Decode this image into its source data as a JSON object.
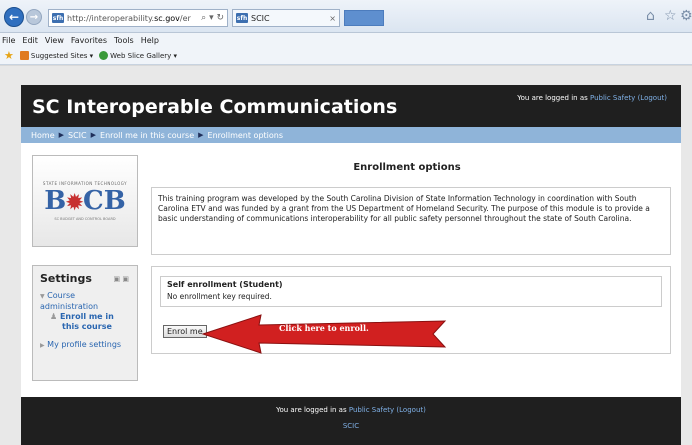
{
  "browser": {
    "url_prefix": "http://interoperability.",
    "url_domain": "sc.gov",
    "url_suffix": "/er",
    "addr_icons": "⌕ ▾ ↻",
    "favicon_text": "sfh",
    "tab_title": "SCIC",
    "tab_close": "×",
    "menu": [
      "File",
      "Edit",
      "View",
      "Favorites",
      "Tools",
      "Help"
    ],
    "favorites": {
      "suggested": "Suggested Sites ▾",
      "webslice": "Web Slice Gallery ▾"
    }
  },
  "header": {
    "site_title": "SC Interoperable Communications",
    "login_prefix": "You are logged in as ",
    "login_user": "Public Safety",
    "logout": "(Logout)"
  },
  "breadcrumb": [
    "Home",
    "SCIC",
    "Enroll me in this course",
    "Enrollment options"
  ],
  "breadcrumb_sep": "▶",
  "logo": {
    "top": "STATE INFORMATION TECHNOLOGY",
    "mark_left": "B",
    "mark_mid": "✹",
    "mark_right": "CB",
    "bottom": "SC BUDGET AND CONTROL BOARD"
  },
  "settings": {
    "title": "Settings",
    "course_admin": "Course administration",
    "enroll_me_line1": "Enroll me in",
    "enroll_me_line2": "this course",
    "profile": "My profile settings"
  },
  "main": {
    "title": "Enrollment options",
    "description": "This training program was developed by the South Carolina Division of State Information Technology in coordination with South Carolina ETV and was funded by a grant from the US Department of Homeland Security.  The purpose of this module is to provide a basic understanding of communications interoperability for all public safety personnel throughout the state of South Carolina.",
    "enrol_legend": "Self enrollment (Student)",
    "no_key": "No enrollment key required.",
    "enrol_button": "Enrol me",
    "arrow_label": "Click here to enroll."
  },
  "footer": {
    "login_prefix": "You are logged in as ",
    "login_user": "Public Safety",
    "logout": "(Logout)",
    "course": "SCIC"
  }
}
